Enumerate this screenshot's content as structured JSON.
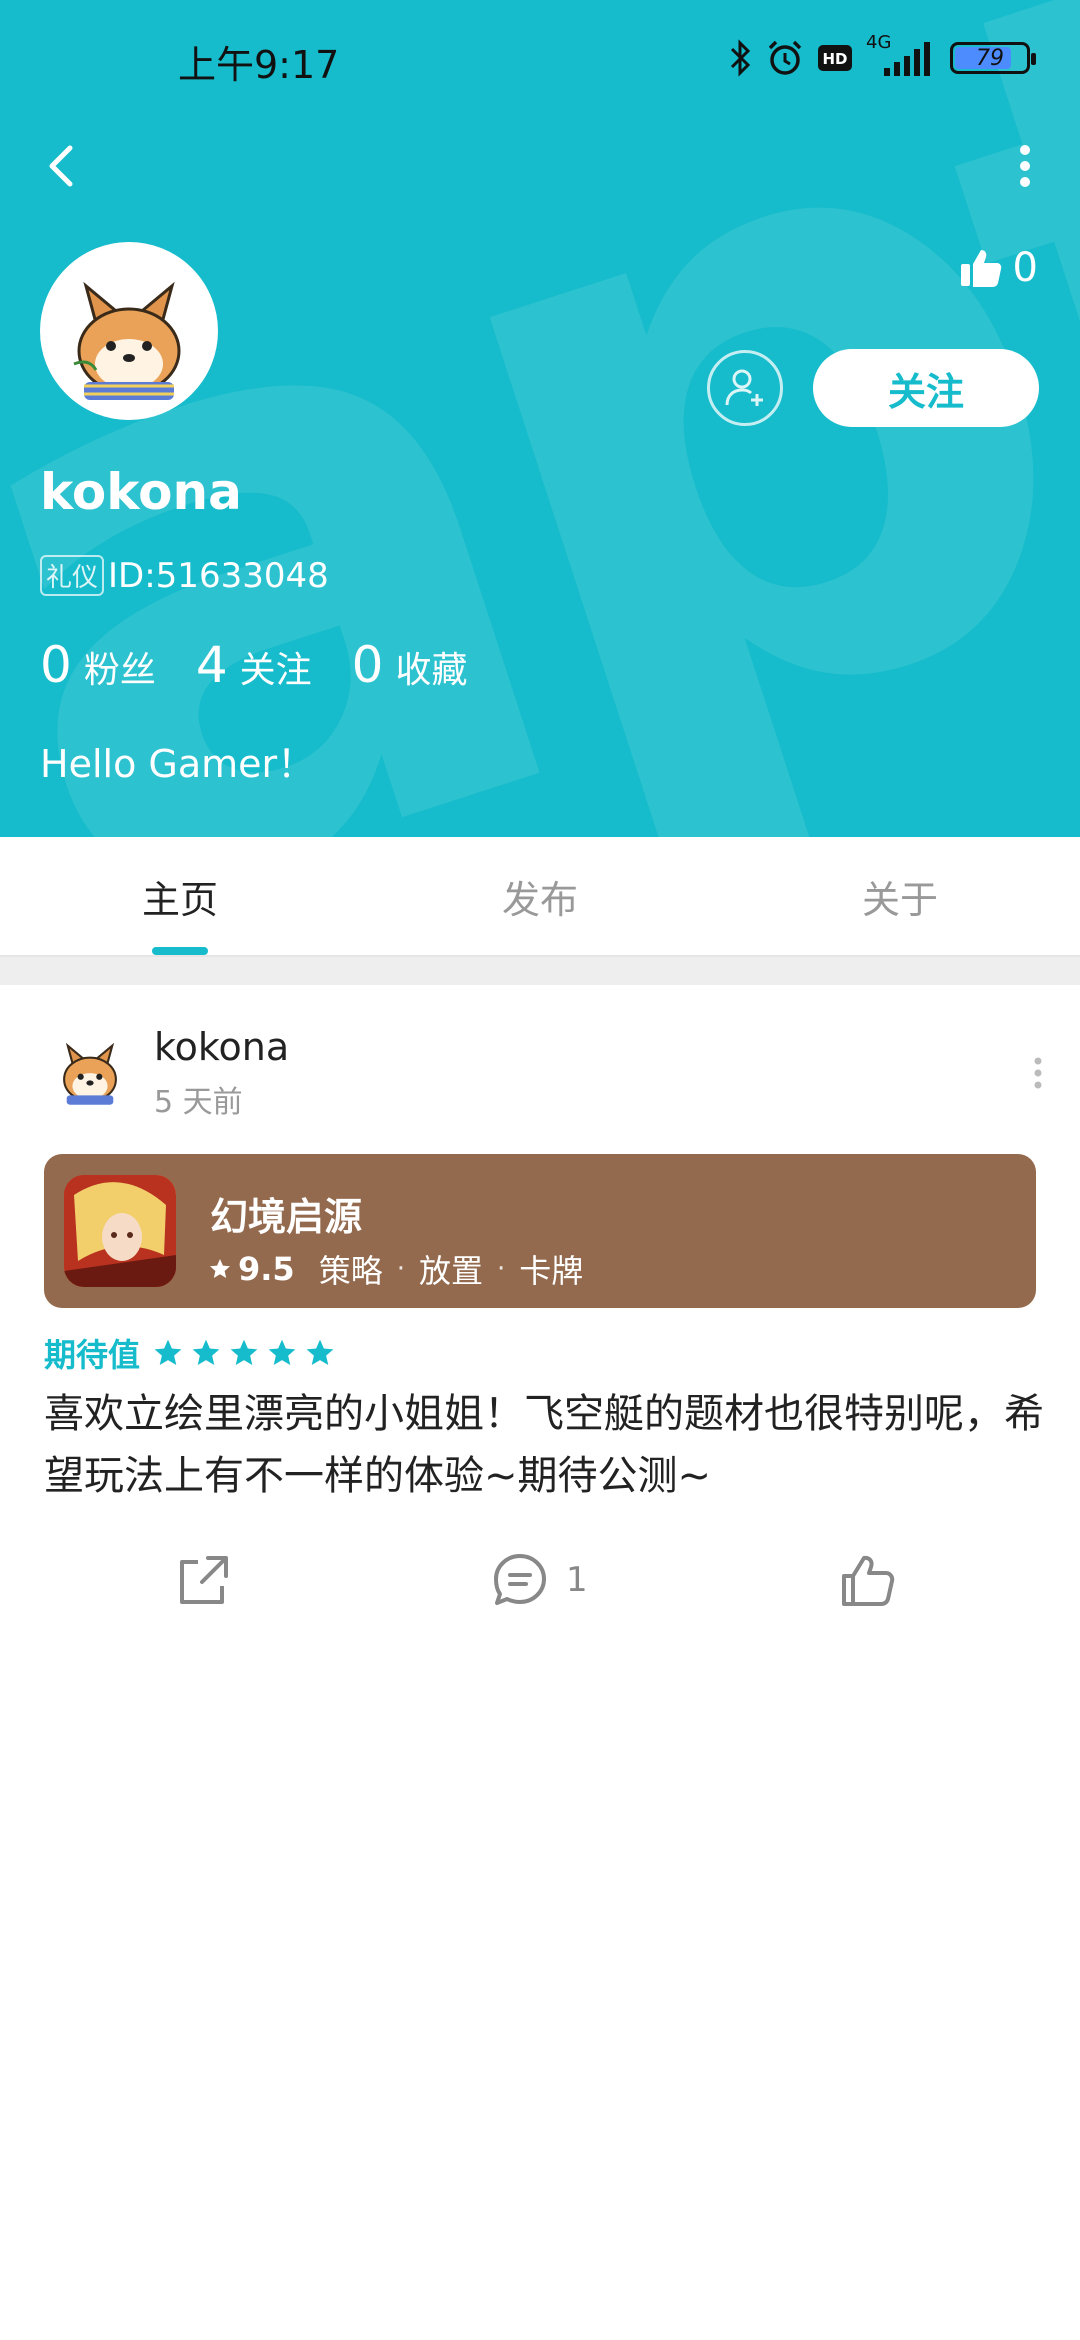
{
  "status_bar": {
    "time": "上午9:17",
    "network": "4G",
    "hd": "HD",
    "battery": "79"
  },
  "profile": {
    "username": "kokona",
    "tag": "礼仪",
    "id_text": "ID:51633048",
    "likes_count": "0",
    "follow_label": "关注",
    "stats": [
      {
        "num": "0",
        "label": "粉丝"
      },
      {
        "num": "4",
        "label": "关注"
      },
      {
        "num": "0",
        "label": "收藏"
      }
    ],
    "bio": "Hello Gamer！"
  },
  "tabs": [
    {
      "label": "主页",
      "active": true
    },
    {
      "label": "发布",
      "active": false
    },
    {
      "label": "关于",
      "active": false
    }
  ],
  "post": {
    "author": "kokona",
    "time": "5 天前",
    "game": {
      "name": "幻境启源",
      "score": "9.5",
      "genres": [
        "策略",
        "放置",
        "卡牌"
      ]
    },
    "expect_label": "期待值",
    "expect_stars": 5,
    "text": "喜欢立绘里漂亮的小姐姐！飞空艇的题材也很特别呢，希望玩法上有不一样的体验~期待公测~",
    "comments_count": "1"
  },
  "colors": {
    "accent": "#16bccb",
    "card_bg": "#936a4e"
  }
}
